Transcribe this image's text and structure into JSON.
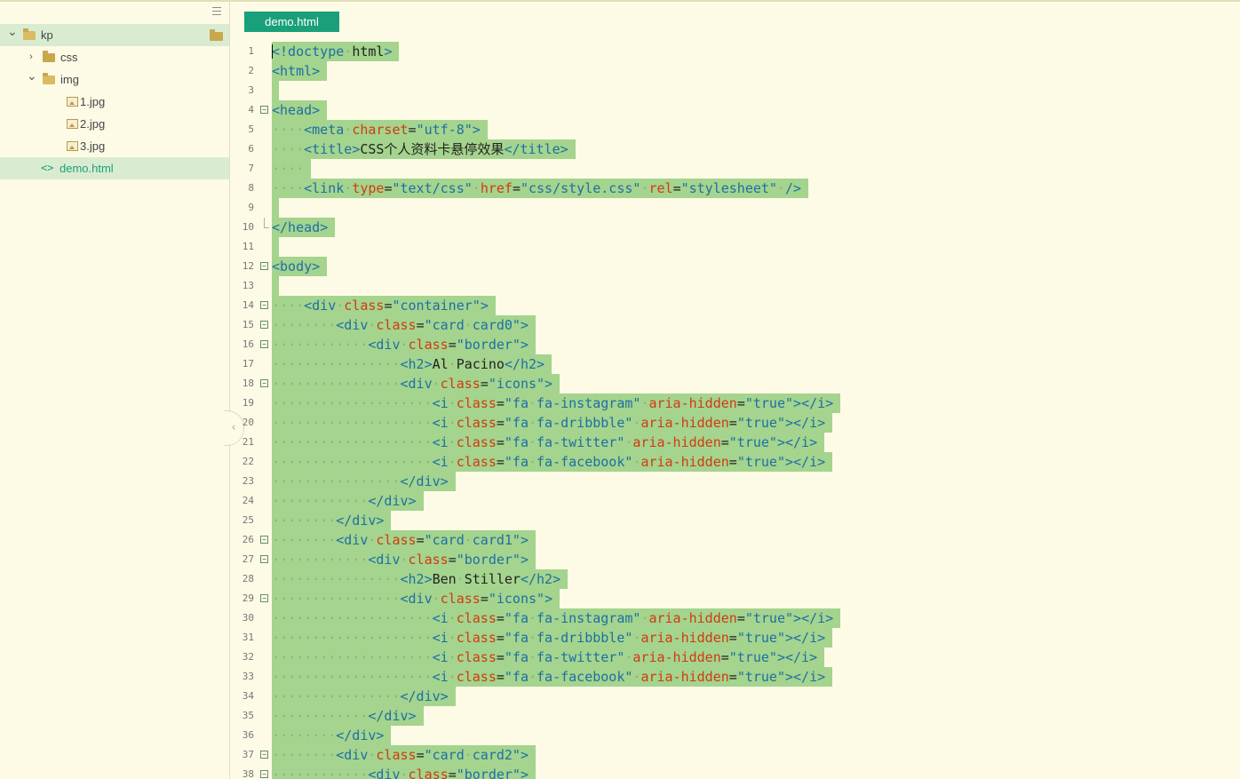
{
  "sidebar": {
    "menu_icon": "hamburger-menu-icon",
    "items": [
      {
        "label": "kp",
        "type": "folder",
        "expanded": true,
        "depth": 0,
        "selected": true
      },
      {
        "label": "css",
        "type": "folder",
        "expanded": false,
        "depth": 1
      },
      {
        "label": "img",
        "type": "folder",
        "expanded": true,
        "depth": 1
      },
      {
        "label": "1.jpg",
        "type": "image",
        "depth": 2
      },
      {
        "label": "2.jpg",
        "type": "image",
        "depth": 2
      },
      {
        "label": "3.jpg",
        "type": "image",
        "depth": 2
      },
      {
        "label": "demo.html",
        "type": "html",
        "depth": 1,
        "active": true
      }
    ]
  },
  "editor": {
    "tab_label": "demo.html",
    "selection_color": "#a4d48d",
    "lines": [
      {
        "n": "1",
        "indent": 0,
        "code": "<!doctype html>"
      },
      {
        "n": "2",
        "indent": 0,
        "code": "<html>"
      },
      {
        "n": "3",
        "indent": 0,
        "code": ""
      },
      {
        "n": "4",
        "indent": 0,
        "code": "<head>",
        "fold": "open"
      },
      {
        "n": "5",
        "indent": 4,
        "code": "<meta charset=\"utf-8\">"
      },
      {
        "n": "6",
        "indent": 4,
        "code": "<title>CSS个人资料卡悬停效果</title>"
      },
      {
        "n": "7",
        "indent": 4,
        "code": ""
      },
      {
        "n": "8",
        "indent": 4,
        "code": "<link type=\"text/css\" href=\"css/style.css\" rel=\"stylesheet\" />"
      },
      {
        "n": "9",
        "indent": 0,
        "code": ""
      },
      {
        "n": "10",
        "indent": 0,
        "code": "</head>",
        "fold": "end"
      },
      {
        "n": "11",
        "indent": 0,
        "code": ""
      },
      {
        "n": "12",
        "indent": 0,
        "code": "<body>",
        "fold": "open"
      },
      {
        "n": "13",
        "indent": 0,
        "code": ""
      },
      {
        "n": "14",
        "indent": 4,
        "code": "<div class=\"container\">",
        "fold": "open"
      },
      {
        "n": "15",
        "indent": 8,
        "code": "<div class=\"card card0\">",
        "fold": "open"
      },
      {
        "n": "16",
        "indent": 12,
        "code": "<div class=\"border\">",
        "fold": "open"
      },
      {
        "n": "17",
        "indent": 16,
        "code": "<h2>Al Pacino</h2>"
      },
      {
        "n": "18",
        "indent": 16,
        "code": "<div class=\"icons\">",
        "fold": "open"
      },
      {
        "n": "19",
        "indent": 20,
        "code": "<i class=\"fa fa-instagram\" aria-hidden=\"true\"></i>"
      },
      {
        "n": "20",
        "indent": 20,
        "code": "<i class=\"fa fa-dribbble\" aria-hidden=\"true\"></i>"
      },
      {
        "n": "21",
        "indent": 20,
        "code": "<i class=\"fa fa-twitter\" aria-hidden=\"true\"></i>"
      },
      {
        "n": "22",
        "indent": 20,
        "code": "<i class=\"fa fa-facebook\" aria-hidden=\"true\"></i>"
      },
      {
        "n": "23",
        "indent": 16,
        "code": "</div>"
      },
      {
        "n": "24",
        "indent": 12,
        "code": "</div>"
      },
      {
        "n": "25",
        "indent": 8,
        "code": "</div>"
      },
      {
        "n": "26",
        "indent": 8,
        "code": "<div class=\"card card1\">",
        "fold": "open"
      },
      {
        "n": "27",
        "indent": 12,
        "code": "<div class=\"border\">",
        "fold": "open"
      },
      {
        "n": "28",
        "indent": 16,
        "code": "<h2>Ben Stiller</h2>"
      },
      {
        "n": "29",
        "indent": 16,
        "code": "<div class=\"icons\">",
        "fold": "open"
      },
      {
        "n": "30",
        "indent": 20,
        "code": "<i class=\"fa fa-instagram\" aria-hidden=\"true\"></i>"
      },
      {
        "n": "31",
        "indent": 20,
        "code": "<i class=\"fa fa-dribbble\" aria-hidden=\"true\"></i>"
      },
      {
        "n": "32",
        "indent": 20,
        "code": "<i class=\"fa fa-twitter\" aria-hidden=\"true\"></i>"
      },
      {
        "n": "33",
        "indent": 20,
        "code": "<i class=\"fa fa-facebook\" aria-hidden=\"true\"></i>"
      },
      {
        "n": "34",
        "indent": 16,
        "code": "</div>"
      },
      {
        "n": "35",
        "indent": 12,
        "code": "</div>"
      },
      {
        "n": "36",
        "indent": 8,
        "code": "</div>"
      },
      {
        "n": "37",
        "indent": 8,
        "code": "<div class=\"card card2\">",
        "fold": "open"
      },
      {
        "n": "38",
        "indent": 12,
        "code": "<div class=\"border\">",
        "fold": "open"
      }
    ]
  }
}
